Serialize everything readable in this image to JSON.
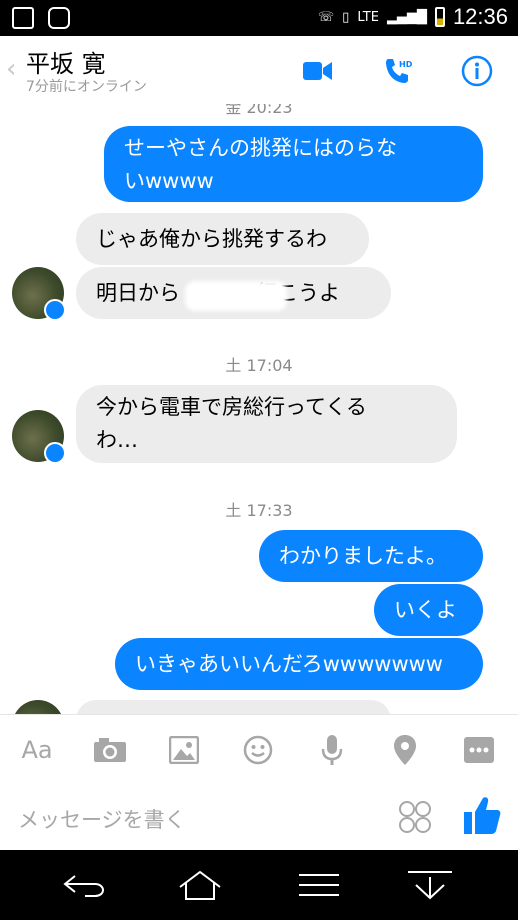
{
  "status_bar": {
    "time": "12:36",
    "network": "LTE"
  },
  "header": {
    "back_glyph": "‹",
    "title": "平坂 寛",
    "subtitle": "7分前にオンライン"
  },
  "messages": {
    "top_timestamp_partial": "金 20:23",
    "m1": "せーやさんの挑発にはのらないwwww",
    "m1_line1": "せーやさんの挑発にはのらな",
    "m1_line2": "いwwww",
    "m2": "じゃあ俺から挑発するわ",
    "m3_prefix": "明日から",
    "m3_suffix": "行こうよ",
    "ts1": "土 17:04",
    "m4_line1": "今から電車で房総行ってくる",
    "m4_line2": "わ…",
    "ts2": "土 17:33",
    "m5": "わかりましたよ。",
    "m6": "いくよ",
    "m7": "いきゃあいいんだろwwwwwww"
  },
  "toolbar": {
    "aa_label": "Aa"
  },
  "composer": {
    "placeholder": "メッセージを書く"
  },
  "colors": {
    "accent": "#0a84ff",
    "incoming": "#ececec"
  }
}
